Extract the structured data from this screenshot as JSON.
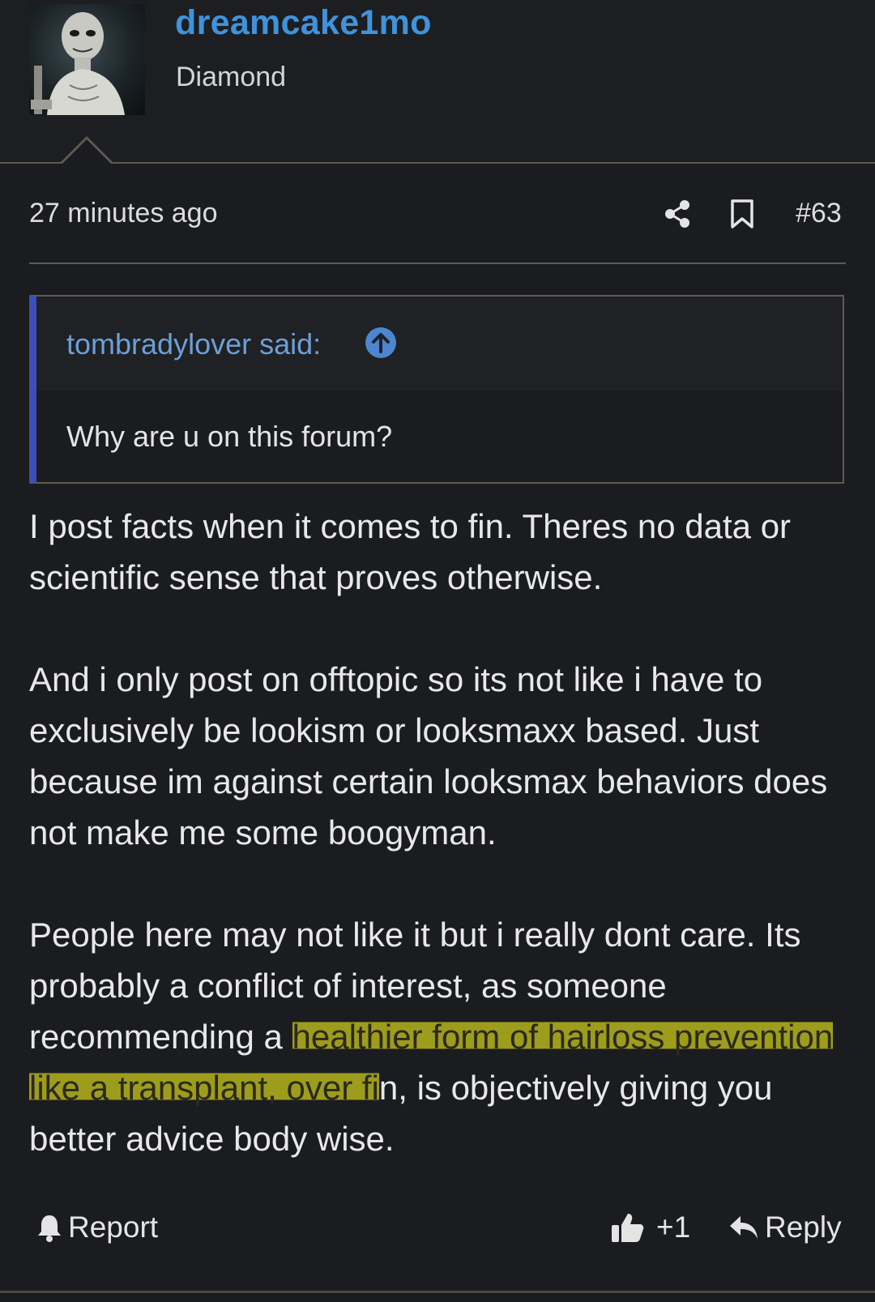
{
  "post": {
    "author": {
      "username": "dreamcake1mo",
      "rank": "Diamond"
    },
    "timestamp": "27 minutes ago",
    "number": "#63",
    "quote": {
      "author_line": "tombradylover said:",
      "text": "Why are u on this forum?"
    },
    "body": {
      "paragraph_1": "I post facts when it comes to fin. Theres no data or scientific sense that proves otherwise.",
      "paragraph_2": "And i only post on offtopic so its not like i have to exclusively be lookism or looksmaxx based. Just because im against certain looksmax behaviors does not make me some boogyman.",
      "paragraph_3_start": "People here may not like it but i really dont care. Its probably a conflict of interest, as someone recommending a ",
      "paragraph_3_highlight": "healthier form of hairloss prevention like a transplant, over fi",
      "paragraph_3_end": "n, is objectively giving you better advice body wise."
    },
    "actions": {
      "report": "Report",
      "like_count": "+1",
      "reply": "Reply"
    },
    "icons": {
      "share": "share-icon",
      "bookmark": "bookmark-icon",
      "quote_jump": "arrow-up-circle-icon",
      "report": "bell-icon",
      "like": "thumbs-up-icon",
      "reply": "reply-arrow-icon"
    },
    "colors": {
      "username": "#3f93dc",
      "quote_author": "#6d9fd6",
      "quote_bar": "#3a4fb8",
      "highlight": "#b5b21c",
      "background": "#1a1c1f"
    }
  }
}
